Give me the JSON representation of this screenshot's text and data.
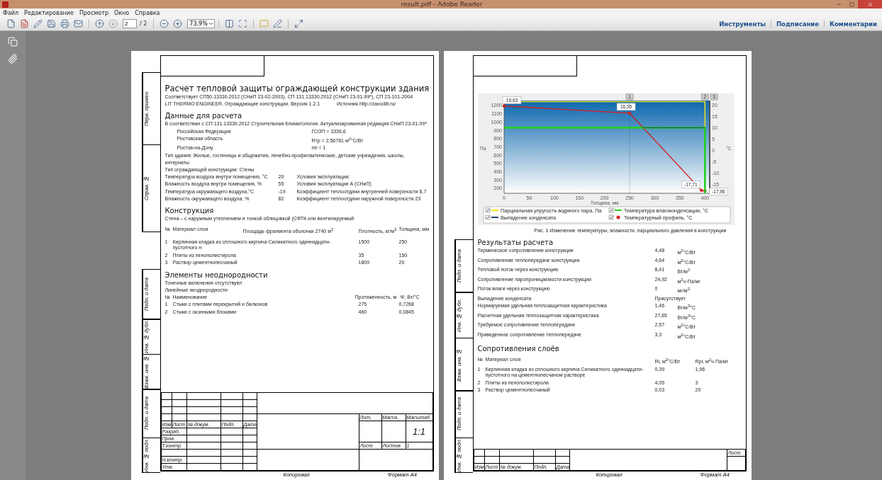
{
  "window": {
    "title": "result.pdf - Adobe Reader"
  },
  "menu": [
    "Файл",
    "Редактирование",
    "Просмотр",
    "Окно",
    "Справка"
  ],
  "toolbar": {
    "page": "2",
    "page_count": "/ 2",
    "zoom": "73,9%"
  },
  "panel_links": [
    "Инструменты",
    "Подписание",
    "Комментарии"
  ],
  "pages": [
    {
      "kind": "calculation",
      "side_stamps_top": [
        "Перв. примен.",
        "Справ. №"
      ],
      "side_stamps": [
        "Подп. и дата",
        "Инв. № дубл.",
        "Взам. инв. №",
        "Подп. и дата",
        "Инв. № подл."
      ],
      "title": "Расчет тепловой защиты ограждающей конструкции здания",
      "standards": "Соответствует СП50.13330.2012 (СНиП 23-02-2003), СП 131.13330.2012 (СНиП 23-01-99*), СП 23-101-2004",
      "software": "LIT THERMO ENGINEER. Ограждающие конструкции. Версия 1.2.1",
      "source": "Источник http://zavodlit.ru/",
      "input_heading": "Данные для расчета",
      "climate_note": "В соответствии с СП 131.13330.2012 Строительная Климатология. Актуализированная редакция СНиП 23-01-99*",
      "location": [
        {
          "place": "Российская Федерация",
          "value": "ГСОП = 3336,6"
        },
        {
          "place": "Ростовская область",
          "value": "Rтр = 2,56781 м$^{2}$°С/Вт"
        },
        {
          "place": "Ростов-на-Дону",
          "value": "mt = 1"
        }
      ],
      "building_type": "Тип здания: Жилые, гостиницы и общежития, лечебно-профилактические, детские учреждения, школы, интернаты",
      "structure_type": "Тип ограждающей конструкции: Стены",
      "params": [
        {
          "label": "Температура воздуха внутри помещения, °С",
          "value": "20",
          "note": "Условия эксплуатации:"
        },
        {
          "label": "Влажность воздуха внутри помещения, %",
          "value": "55",
          "note": "Условия эксплуатации А (СНиП)"
        },
        {
          "label": "Температура окружающего воздуха,°С",
          "value": "-19",
          "note": "Коэффициент теплоотдачи внутренней поверхности 8,7"
        },
        {
          "label": "Влажность окружающего воздуха, %",
          "value": "82",
          "note": "Коэффициент теплоотдачи наружной поверхности  23"
        }
      ],
      "construction_heading": "Конструкция",
      "construction_note": "Стена – с наружным утеплением и тонкой облицовкой (СФТК или вентилируемый",
      "layer_columns": [
        "№",
        "Материал слоя",
        "Площадь фрагмента оболочки 2740 м$^{2}$",
        "Плотность, кг/м$^{3}$",
        "Толщина, мм"
      ],
      "layers": [
        {
          "n": "1",
          "material": "Кирпичная кладка из сплошного кирпича Силикатного одиннадцати- пустотного н",
          "density": "1500",
          "thickness": "250"
        },
        {
          "n": "2",
          "material": "Плиты из пенополистирола",
          "density": "35",
          "thickness": "150"
        },
        {
          "n": "3",
          "material": "Раствор цементнопесчаный",
          "density": "1800",
          "thickness": "20"
        }
      ],
      "inhomogeneity_heading": "Элементы неоднородности",
      "point_note": "Точечные включения отсутствуют",
      "linear_heading": "Линейные неоднородности",
      "linear_columns": [
        "№",
        "Наименование",
        "Протяженность, м",
        "Ψ, Вт/°С"
      ],
      "linear": [
        {
          "n": "1",
          "name": "Стыки с плитами перекрытий и балконов",
          "length": "275",
          "psi": "0,7268"
        },
        {
          "n": "2",
          "name": "Стыки с оконными блоками",
          "length": "460",
          "psi": "0,0845"
        }
      ],
      "stamp": {
        "kind": "main",
        "headers": [
          "Изм",
          "Лист",
          "№ докум.",
          "Подп.",
          "Дата"
        ],
        "roles": [
          "Разраб.",
          "Пров.",
          "Т.контр.",
          "Н.контр.",
          "Утв."
        ],
        "lit": "Лит.",
        "mass": "Масса",
        "scale_label": "Масштаб",
        "scale": "1:1",
        "sheet_label": "Лист",
        "sheets_label": "Листов",
        "sheets": "1"
      },
      "footer": [
        "Копировал",
        "Формат   А4"
      ]
    },
    {
      "kind": "results",
      "side_stamps": [
        "Подп. и дата",
        "Инв. № дубл.",
        "Взам. инв. №",
        "Подп. и дата",
        "Инв. № подл."
      ],
      "chart": {
        "pressure_label": "Па",
        "markers": [
          "1",
          "2",
          "3"
        ],
        "pressure_ticks": [
          "1200",
          "1100",
          "1000",
          "900",
          "800",
          "700",
          "600",
          "500",
          "400",
          "300",
          "200"
        ],
        "legend": [
          {
            "label": "Парциальная упругость водяного пара, Па",
            "color": "#f2e21a",
            "checked": true,
            "kind": "line"
          },
          {
            "label": "Выпадение конденсата",
            "color": "#1d3a66",
            "checked": true,
            "kind": "line"
          },
          {
            "label": "Температура влагоконденсации, °С",
            "color": "#22d022",
            "checked": true,
            "kind": "line"
          },
          {
            "label": "Температурный профиль, °С",
            "color": "#d81c1c",
            "checked": true,
            "kind": "dot"
          }
        ],
        "chart_data": {
          "type": "line",
          "xlabel": "Толщина, мм",
          "ylabel": "°С",
          "x": [
            0,
            250,
            275,
            393,
            400,
            400
          ],
          "series": [
            {
              "color": "#d81c1c",
              "values": [
                19.6,
                16.4,
                10.4,
                -17.7,
                -18,
                null
              ]
            },
            {
              "color": "#22d022",
              "values": [
                10,
                10,
                10,
                10,
                10,
                -19
              ]
            },
            {
              "color": "#1d3a66",
              "values": [
                null,
                null,
                10,
                10,
                10,
                null
              ]
            }
          ],
          "xlim": [
            0,
            408
          ],
          "ylim": [
            -19,
            22
          ],
          "xticks": [
            0,
            50,
            100,
            150,
            200,
            250,
            300,
            350,
            400
          ],
          "yticks": [
            -15,
            -10,
            -5,
            0,
            5,
            10,
            15,
            20
          ],
          "value_labels": [
            "19,63",
            "16,35",
            null,
            "-17,71",
            "-17,96",
            null
          ]
        }
      },
      "caption": "Рис. 1 Изменение температуры, влажности, парциального давления в конструкции",
      "results_heading": "Результаты расчета",
      "results": [
        {
          "label": "Термическое сопротивление конструкции",
          "value": "4,48",
          "unit": "м$^{2}$°С/Вт"
        },
        {
          "label": "Сопротивление теплопередаче конструкции",
          "value": "4,64",
          "unit": "м$^{2}$°С/Вт"
        },
        {
          "label": "Тепловой поток через конструкцию",
          "value": "8,41",
          "unit": "Вт/м$^{2}$"
        },
        {
          "label": "Сопротивление паропроницаемости конструкции",
          "value": "24,92",
          "unit": "м$^{2}$ч·Па/мг"
        },
        {
          "label": "Поток влаги через конструкцию",
          "value": "0",
          "unit": "мг/м$^{2}$"
        },
        {
          "label": "Выпадение конденсата",
          "value": "Присутствует"
        },
        {
          "label": "Нормируемая удельная теплозащитная характеристика",
          "value": "1,46",
          "unit": "Вт/м$^{3}$°С"
        },
        {
          "label": "Расчетная удельная теплозащитная характеристика",
          "value": "27,65",
          "unit": "Вт/м$^{3}$°С"
        },
        {
          "label": "Требуемое сопротивление теплопередаче",
          "value": "2,57",
          "unit": "м$^{2}$°С/Вт"
        },
        {
          "label": "Приведенное сопротивление теплопередаче",
          "value": "3,3",
          "unit": "м$^{2}$°С/Вт"
        }
      ],
      "resist_heading": "Сопротивления слоёв",
      "resist_columns": [
        "№",
        "Материал слоя",
        "Ri, м$^{2}$°С/Вт",
        "Rpi, м$^{2}$ч·Па/мг"
      ],
      "resist": [
        {
          "n": "1",
          "material": "Кирпичная кладка из сплошного кирпича Силикатного одиннадцати- пустотного на цементнопесчаном растворе",
          "ri": "0,39",
          "rpi": "1,96"
        },
        {
          "n": "2",
          "material": "Плиты из пенополистирола",
          "ri": "4,05",
          "rpi": "3"
        },
        {
          "n": "3",
          "material": "Раствор цементнопесчаный",
          "ri": "0,03",
          "rpi": "20"
        }
      ],
      "stamp": {
        "kind": "sheet",
        "headers": [
          "Изм",
          "Лист",
          "№ докум.",
          "Подп.",
          "Дата"
        ],
        "sheet_label": "Лист"
      },
      "footer": [
        "Копировал",
        "Формат   А4"
      ]
    }
  ]
}
